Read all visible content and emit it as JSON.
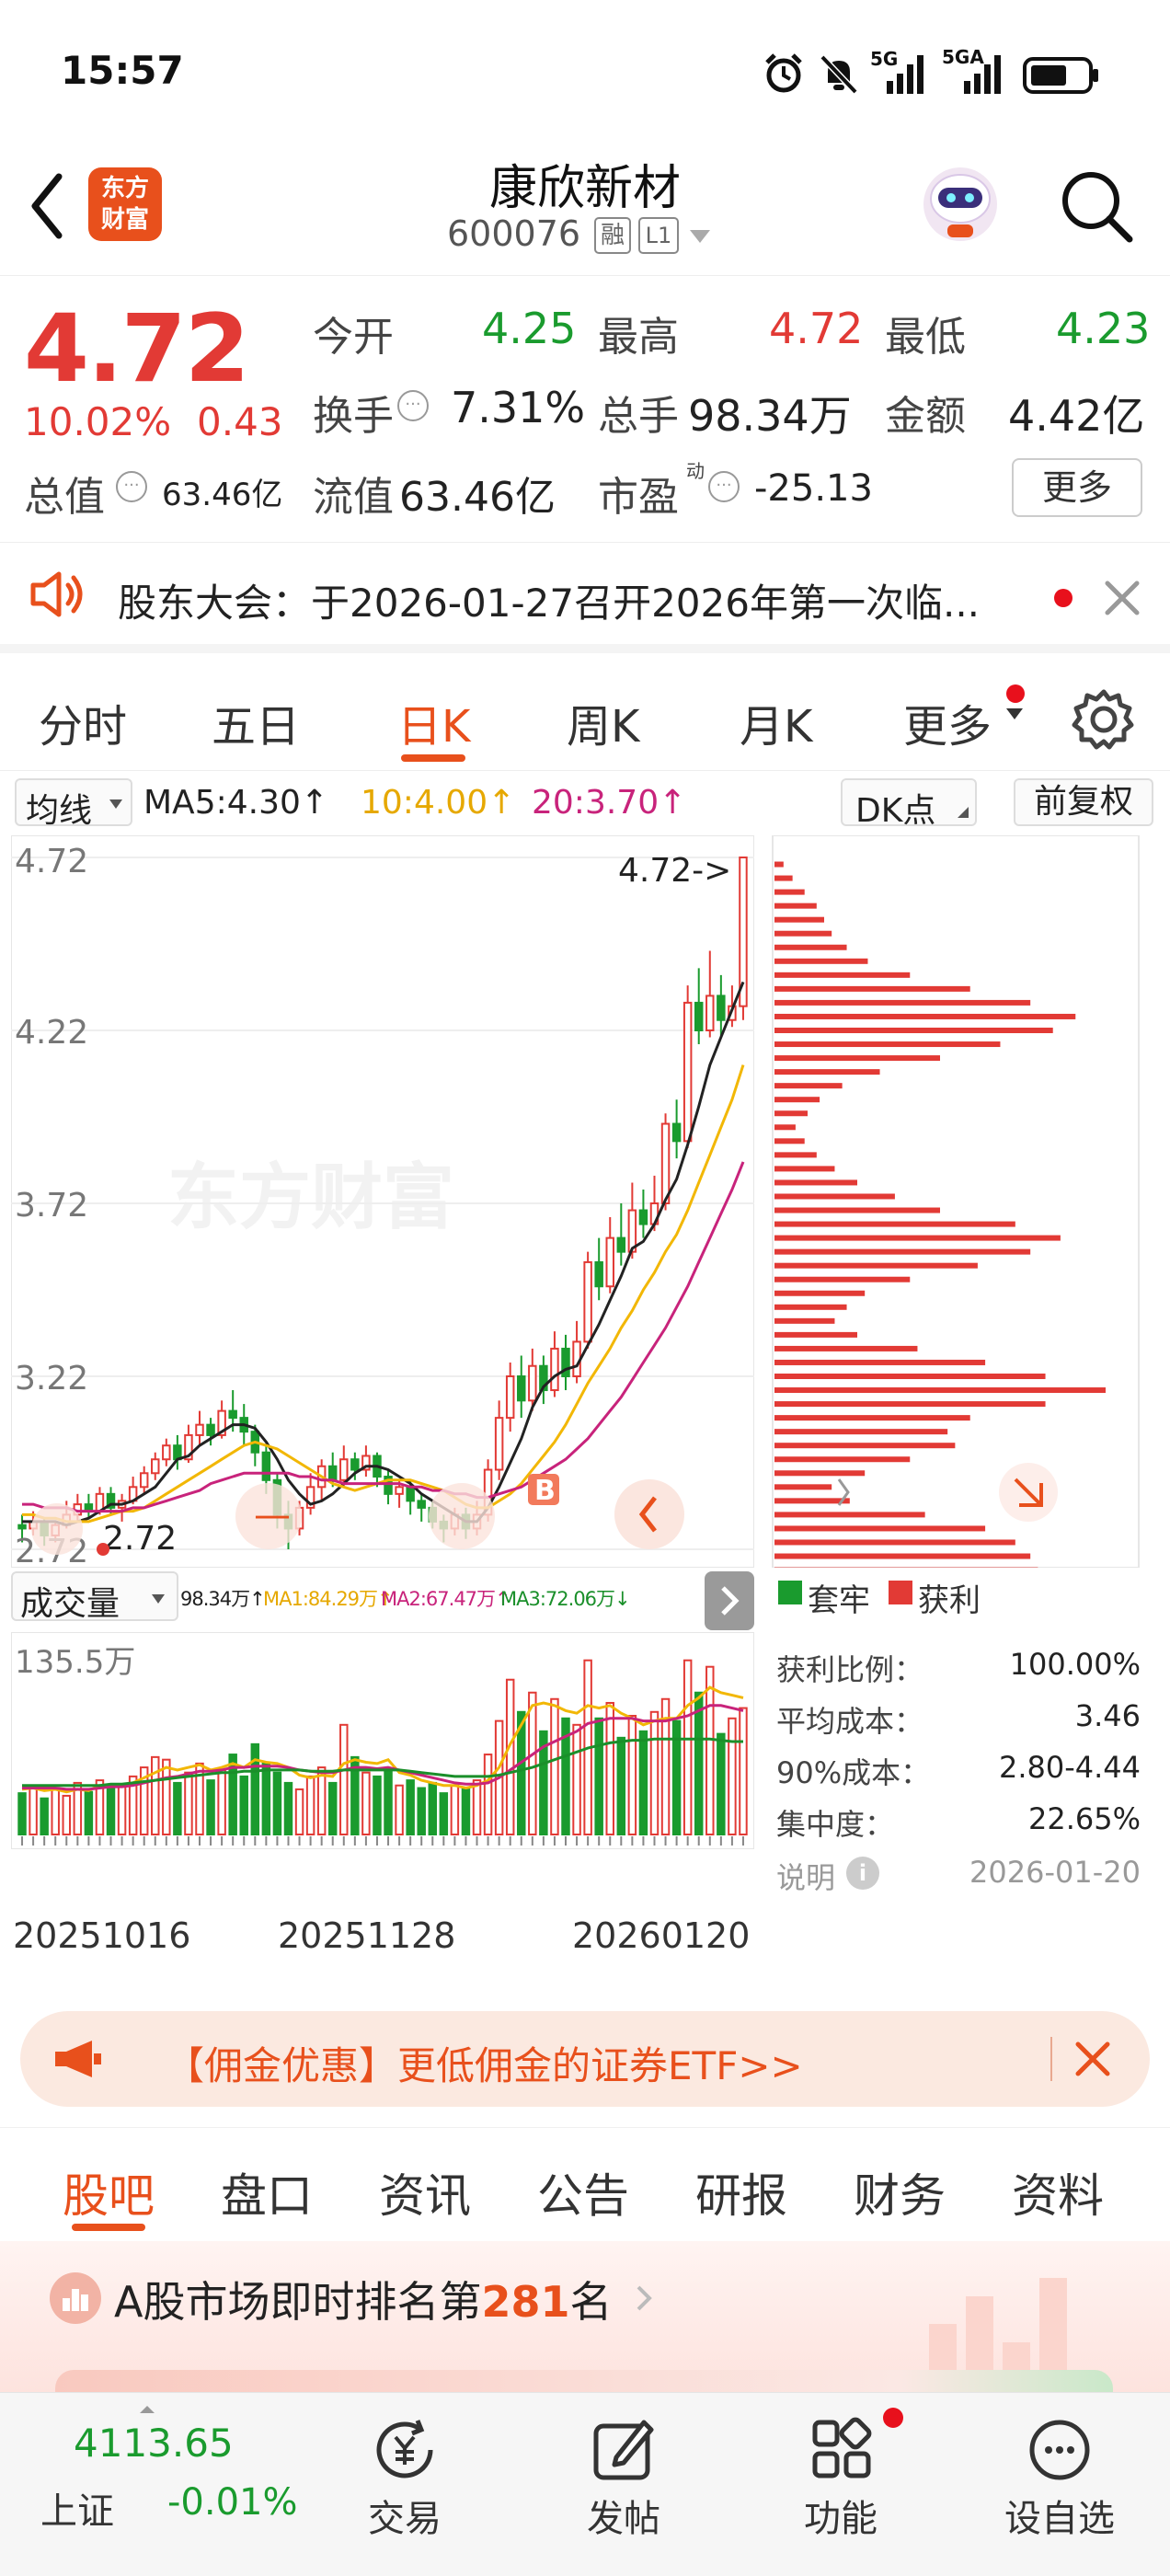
{
  "status_bar": {
    "time": "15:57",
    "signal1": "5G",
    "signal2": "5GA"
  },
  "header": {
    "title": "康欣新材",
    "code": "600076",
    "badge_margin": "融",
    "badge_level": "L1",
    "logo_line1": "东方",
    "logo_line2": "财富"
  },
  "quote": {
    "price": "4.72",
    "change_pct": "10.02%",
    "change": "0.43",
    "open_label": "今开",
    "open": "4.25",
    "high_label": "最高",
    "high": "4.72",
    "low_label": "最低",
    "low": "4.23",
    "turnover_label": "换手",
    "turnover": "7.31%",
    "volume_label": "总手",
    "volume": "98.34万",
    "amount_label": "金额",
    "amount": "4.42亿",
    "mktcap_label": "总值",
    "mktcap": "63.46亿",
    "float_label": "流值",
    "float": "63.46亿",
    "pe_label": "市盈",
    "pe_sup": "动",
    "pe": "-25.13",
    "more_button": "更多"
  },
  "notice": {
    "text": "股东大会：于2026-01-27召开2026年第一次临..."
  },
  "period_tabs": [
    "分时",
    "五日",
    "日K",
    "周K",
    "月K",
    "更多"
  ],
  "active_period": "日K",
  "ma_bar": {
    "select": "均线",
    "ma5": "MA5:4.30↑",
    "ma10": "10:4.00↑",
    "ma20": "20:3.70↑",
    "dk": "DK点",
    "adjust": "前复权"
  },
  "price_chart": {
    "ticks": [
      "4.72",
      "4.22",
      "3.72",
      "3.22",
      "2.72"
    ],
    "high_marker": "4.72->",
    "low_marker": "2.72",
    "b_marker": "B",
    "watermark": "东方财富"
  },
  "volume_bar": {
    "select": "成交量",
    "vol": "98.34万↑",
    "ma1": "MA1:84.29万↑",
    "ma2": "MA2:67.47万↑",
    "ma3": "MA3:72.06万↓",
    "max": "135.5万"
  },
  "dates": [
    "20251016",
    "20251128",
    "20260120"
  ],
  "chip": {
    "legend_trapped": "套牢",
    "legend_profit": "获利",
    "profit_ratio_label": "获利比例：",
    "profit_ratio": "100.00%",
    "avg_cost_label": "平均成本：",
    "avg_cost": "3.46",
    "cost90_label": "90%成本：",
    "cost90": "2.80-4.44",
    "concentration_label": "集中度：",
    "concentration": "22.65%",
    "note_label": "说明",
    "date": "2026-01-20"
  },
  "promo": {
    "text": "【佣金优惠】更低佣金的证券ETF>>"
  },
  "content_tabs": [
    "股吧",
    "盘口",
    "资讯",
    "公告",
    "研报",
    "财务",
    "资料"
  ],
  "active_content_tab": "股吧",
  "rank": {
    "prefix": "A股市场即时排名第",
    "number": "281",
    "suffix": "名"
  },
  "footer": {
    "index_value": "4113.65",
    "index_name": "上证",
    "index_change": "-0.01%",
    "trade": "交易",
    "post": "发帖",
    "func": "功能",
    "watch": "设自选"
  },
  "colors": {
    "up": "#e23a35",
    "down": "#1a9b2e",
    "accent": "#e8501c",
    "ma5": "#222222",
    "ma10": "#f2b705",
    "ma20": "#c8237b"
  },
  "chart_data": {
    "type": "candlestick",
    "candles": [
      [
        2.79,
        2.78,
        2.82,
        2.74
      ],
      [
        2.78,
        2.8,
        2.83,
        2.76
      ],
      [
        2.8,
        2.76,
        2.81,
        2.73
      ],
      [
        2.76,
        2.79,
        2.8,
        2.74
      ],
      [
        2.79,
        2.82,
        2.86,
        2.78
      ],
      [
        2.82,
        2.85,
        2.88,
        2.8
      ],
      [
        2.85,
        2.83,
        2.88,
        2.81
      ],
      [
        2.83,
        2.88,
        2.9,
        2.82
      ],
      [
        2.88,
        2.84,
        2.9,
        2.82
      ],
      [
        2.84,
        2.86,
        2.88,
        2.8
      ],
      [
        2.86,
        2.9,
        2.93,
        2.85
      ],
      [
        2.9,
        2.94,
        2.96,
        2.88
      ],
      [
        2.94,
        2.98,
        3.0,
        2.92
      ],
      [
        2.98,
        3.02,
        3.04,
        2.96
      ],
      [
        3.02,
        2.98,
        3.05,
        2.95
      ],
      [
        2.98,
        3.05,
        3.08,
        2.97
      ],
      [
        3.05,
        3.08,
        3.12,
        3.02
      ],
      [
        3.08,
        3.05,
        3.1,
        3.02
      ],
      [
        3.05,
        3.12,
        3.15,
        3.04
      ],
      [
        3.12,
        3.1,
        3.18,
        3.06
      ],
      [
        3.1,
        3.06,
        3.14,
        3.02
      ],
      [
        3.06,
        3.0,
        3.08,
        2.96
      ],
      [
        3.0,
        2.92,
        3.02,
        2.88
      ],
      [
        2.92,
        2.82,
        2.94,
        2.78
      ],
      [
        2.82,
        2.78,
        2.86,
        2.72
      ],
      [
        2.78,
        2.84,
        2.86,
        2.76
      ],
      [
        2.84,
        2.9,
        2.94,
        2.82
      ],
      [
        2.9,
        2.96,
        2.98,
        2.86
      ],
      [
        2.96,
        2.92,
        3.0,
        2.9
      ],
      [
        2.92,
        2.98,
        3.02,
        2.9
      ],
      [
        2.98,
        2.95,
        3.0,
        2.92
      ],
      [
        2.95,
        2.99,
        3.02,
        2.93
      ],
      [
        2.99,
        2.93,
        3.0,
        2.9
      ],
      [
        2.93,
        2.88,
        2.95,
        2.85
      ],
      [
        2.88,
        2.9,
        2.92,
        2.84
      ],
      [
        2.9,
        2.86,
        2.92,
        2.82
      ],
      [
        2.86,
        2.84,
        2.88,
        2.8
      ],
      [
        2.84,
        2.8,
        2.86,
        2.78
      ],
      [
        2.8,
        2.78,
        2.82,
        2.74
      ],
      [
        2.78,
        2.82,
        2.84,
        2.76
      ],
      [
        2.82,
        2.78,
        2.84,
        2.75
      ],
      [
        2.78,
        2.82,
        2.86,
        2.76
      ],
      [
        2.82,
        2.95,
        2.98,
        2.8
      ],
      [
        2.95,
        3.1,
        3.15,
        2.92
      ],
      [
        3.1,
        3.22,
        3.26,
        3.06
      ],
      [
        3.22,
        3.15,
        3.28,
        3.1
      ],
      [
        3.15,
        3.25,
        3.3,
        3.12
      ],
      [
        3.25,
        3.18,
        3.28,
        3.14
      ],
      [
        3.18,
        3.3,
        3.35,
        3.16
      ],
      [
        3.3,
        3.22,
        3.34,
        3.18
      ],
      [
        3.22,
        3.32,
        3.38,
        3.2
      ],
      [
        3.32,
        3.55,
        3.58,
        3.3
      ],
      [
        3.55,
        3.48,
        3.62,
        3.44
      ],
      [
        3.48,
        3.62,
        3.68,
        3.46
      ],
      [
        3.62,
        3.58,
        3.72,
        3.54
      ],
      [
        3.58,
        3.7,
        3.78,
        3.56
      ],
      [
        3.7,
        3.66,
        3.76,
        3.62
      ],
      [
        3.66,
        3.72,
        3.8,
        3.64
      ],
      [
        3.72,
        3.95,
        3.98,
        3.7
      ],
      [
        3.95,
        3.9,
        4.02,
        3.85
      ],
      [
        3.9,
        4.3,
        4.35,
        3.88
      ],
      [
        4.3,
        4.22,
        4.4,
        4.18
      ],
      [
        4.22,
        4.32,
        4.45,
        4.2
      ],
      [
        4.32,
        4.25,
        4.38,
        4.2
      ],
      [
        4.25,
        4.29,
        4.35,
        4.23
      ],
      [
        4.29,
        4.72,
        4.72,
        4.25
      ]
    ],
    "ma5": [
      2.8,
      2.8,
      2.8,
      2.8,
      2.79,
      2.8,
      2.81,
      2.83,
      2.85,
      2.85,
      2.86,
      2.88,
      2.9,
      2.94,
      2.98,
      2.99,
      3.02,
      3.04,
      3.06,
      3.08,
      3.08,
      3.07,
      3.03,
      2.98,
      2.92,
      2.88,
      2.85,
      2.86,
      2.88,
      2.91,
      2.94,
      2.96,
      2.96,
      2.95,
      2.93,
      2.91,
      2.88,
      2.86,
      2.84,
      2.82,
      2.8,
      2.8,
      2.84,
      2.9,
      2.97,
      3.04,
      3.13,
      3.19,
      3.22,
      3.24,
      3.25,
      3.31,
      3.37,
      3.44,
      3.51,
      3.59,
      3.61,
      3.66,
      3.73,
      3.79,
      3.89,
      4.0,
      4.12,
      4.2,
      4.28,
      4.36
    ],
    "ma10": [
      2.82,
      2.82,
      2.81,
      2.81,
      2.8,
      2.8,
      2.8,
      2.81,
      2.82,
      2.83,
      2.83,
      2.84,
      2.86,
      2.88,
      2.9,
      2.92,
      2.94,
      2.96,
      2.98,
      3.0,
      3.02,
      3.03,
      3.02,
      3.01,
      2.99,
      2.97,
      2.95,
      2.93,
      2.91,
      2.9,
      2.89,
      2.9,
      2.91,
      2.92,
      2.92,
      2.92,
      2.91,
      2.9,
      2.89,
      2.87,
      2.85,
      2.84,
      2.84,
      2.86,
      2.88,
      2.91,
      2.95,
      2.99,
      3.03,
      3.08,
      3.14,
      3.2,
      3.25,
      3.3,
      3.36,
      3.41,
      3.47,
      3.52,
      3.58,
      3.63,
      3.7,
      3.78,
      3.86,
      3.94,
      4.02,
      4.12
    ],
    "ma20": [
      2.85,
      2.85,
      2.84,
      2.84,
      2.84,
      2.83,
      2.83,
      2.83,
      2.83,
      2.83,
      2.84,
      2.84,
      2.85,
      2.86,
      2.87,
      2.88,
      2.89,
      2.91,
      2.92,
      2.93,
      2.94,
      2.94,
      2.94,
      2.94,
      2.94,
      2.93,
      2.93,
      2.92,
      2.92,
      2.91,
      2.91,
      2.91,
      2.91,
      2.91,
      2.91,
      2.9,
      2.9,
      2.89,
      2.89,
      2.88,
      2.88,
      2.87,
      2.87,
      2.88,
      2.89,
      2.9,
      2.92,
      2.94,
      2.96,
      2.98,
      3.01,
      3.04,
      3.08,
      3.12,
      3.16,
      3.21,
      3.26,
      3.31,
      3.36,
      3.42,
      3.48,
      3.55,
      3.62,
      3.69,
      3.76,
      3.84
    ],
    "volume_wan": [
      32,
      38,
      28,
      35,
      30,
      40,
      33,
      42,
      36,
      38,
      45,
      52,
      60,
      58,
      40,
      48,
      55,
      42,
      50,
      62,
      45,
      70,
      55,
      48,
      40,
      35,
      45,
      52,
      40,
      85,
      60,
      48,
      45,
      50,
      38,
      42,
      36,
      40,
      32,
      38,
      35,
      42,
      62,
      88,
      120,
      95,
      110,
      80,
      105,
      90,
      85,
      135,
      90,
      102,
      75,
      92,
      80,
      95,
      105,
      88,
      135,
      110,
      130,
      78,
      90,
      98
    ],
    "volume_up": [
      false,
      true,
      false,
      true,
      true,
      true,
      false,
      true,
      false,
      true,
      true,
      true,
      true,
      true,
      false,
      true,
      true,
      false,
      true,
      false,
      false,
      false,
      false,
      false,
      false,
      true,
      true,
      true,
      false,
      true,
      false,
      true,
      false,
      false,
      true,
      false,
      false,
      false,
      false,
      true,
      false,
      true,
      true,
      true,
      true,
      false,
      true,
      false,
      true,
      false,
      true,
      true,
      false,
      true,
      false,
      true,
      false,
      true,
      true,
      false,
      true,
      false,
      true,
      false,
      true,
      true
    ],
    "vol_ma1": [
      35,
      36,
      34,
      35,
      33,
      35,
      34,
      38,
      37,
      38,
      40,
      44,
      48,
      52,
      50,
      52,
      54,
      50,
      52,
      55,
      52,
      58,
      56,
      55,
      52,
      46,
      44,
      46,
      45,
      55,
      58,
      56,
      55,
      58,
      48,
      46,
      42,
      40,
      38,
      38,
      36,
      38,
      42,
      52,
      70,
      85,
      100,
      102,
      100,
      96,
      94,
      100,
      98,
      100,
      94,
      90,
      85,
      88,
      90,
      90,
      100,
      106,
      114,
      110,
      108,
      106
    ],
    "vol_ma2": [
      36,
      36,
      36,
      36,
      35,
      35,
      35,
      36,
      37,
      37,
      38,
      40,
      42,
      44,
      45,
      47,
      49,
      49,
      50,
      52,
      52,
      53,
      53,
      53,
      52,
      50,
      49,
      48,
      48,
      50,
      52,
      52,
      51,
      52,
      50,
      48,
      46,
      44,
      42,
      40,
      39,
      39,
      40,
      44,
      50,
      56,
      62,
      68,
      72,
      76,
      80,
      86,
      88,
      90,
      90,
      90,
      88,
      88,
      88,
      90,
      92,
      96,
      100,
      100,
      98,
      96
    ],
    "vol_ma3": [
      38,
      38,
      38,
      38,
      38,
      38,
      38,
      38,
      39,
      39,
      40,
      41,
      42,
      43,
      44,
      45,
      46,
      47,
      48,
      48,
      49,
      49,
      50,
      50,
      50,
      50,
      49,
      49,
      49,
      50,
      50,
      50,
      50,
      50,
      50,
      49,
      48,
      47,
      46,
      45,
      45,
      45,
      45,
      46,
      48,
      50,
      52,
      55,
      58,
      61,
      64,
      67,
      69,
      71,
      72,
      73,
      73,
      74,
      74,
      74,
      74,
      74,
      74,
      73,
      72,
      72
    ],
    "chip_distribution": [
      [
        4.7,
        6
      ],
      [
        4.66,
        12
      ],
      [
        4.62,
        20
      ],
      [
        4.58,
        28
      ],
      [
        4.54,
        33
      ],
      [
        4.5,
        38
      ],
      [
        4.46,
        48
      ],
      [
        4.42,
        62
      ],
      [
        4.38,
        90
      ],
      [
        4.34,
        130
      ],
      [
        4.3,
        170
      ],
      [
        4.26,
        200
      ],
      [
        4.22,
        185
      ],
      [
        4.18,
        150
      ],
      [
        4.14,
        110
      ],
      [
        4.1,
        70
      ],
      [
        4.06,
        45
      ],
      [
        4.02,
        30
      ],
      [
        3.98,
        22
      ],
      [
        3.94,
        14
      ],
      [
        3.9,
        20
      ],
      [
        3.86,
        28
      ],
      [
        3.82,
        40
      ],
      [
        3.78,
        55
      ],
      [
        3.74,
        80
      ],
      [
        3.7,
        110
      ],
      [
        3.66,
        160
      ],
      [
        3.62,
        190
      ],
      [
        3.58,
        170
      ],
      [
        3.54,
        135
      ],
      [
        3.5,
        90
      ],
      [
        3.46,
        60
      ],
      [
        3.42,
        48
      ],
      [
        3.38,
        40
      ],
      [
        3.34,
        55
      ],
      [
        3.3,
        95
      ],
      [
        3.26,
        140
      ],
      [
        3.22,
        180
      ],
      [
        3.18,
        220
      ],
      [
        3.14,
        180
      ],
      [
        3.1,
        130
      ],
      [
        3.06,
        115
      ],
      [
        3.02,
        120
      ],
      [
        2.98,
        90
      ],
      [
        2.94,
        60
      ],
      [
        2.9,
        38
      ],
      [
        2.86,
        50
      ],
      [
        2.82,
        100
      ],
      [
        2.78,
        140
      ],
      [
        2.74,
        160
      ],
      [
        2.7,
        170
      ],
      [
        2.66,
        175
      ]
    ]
  }
}
